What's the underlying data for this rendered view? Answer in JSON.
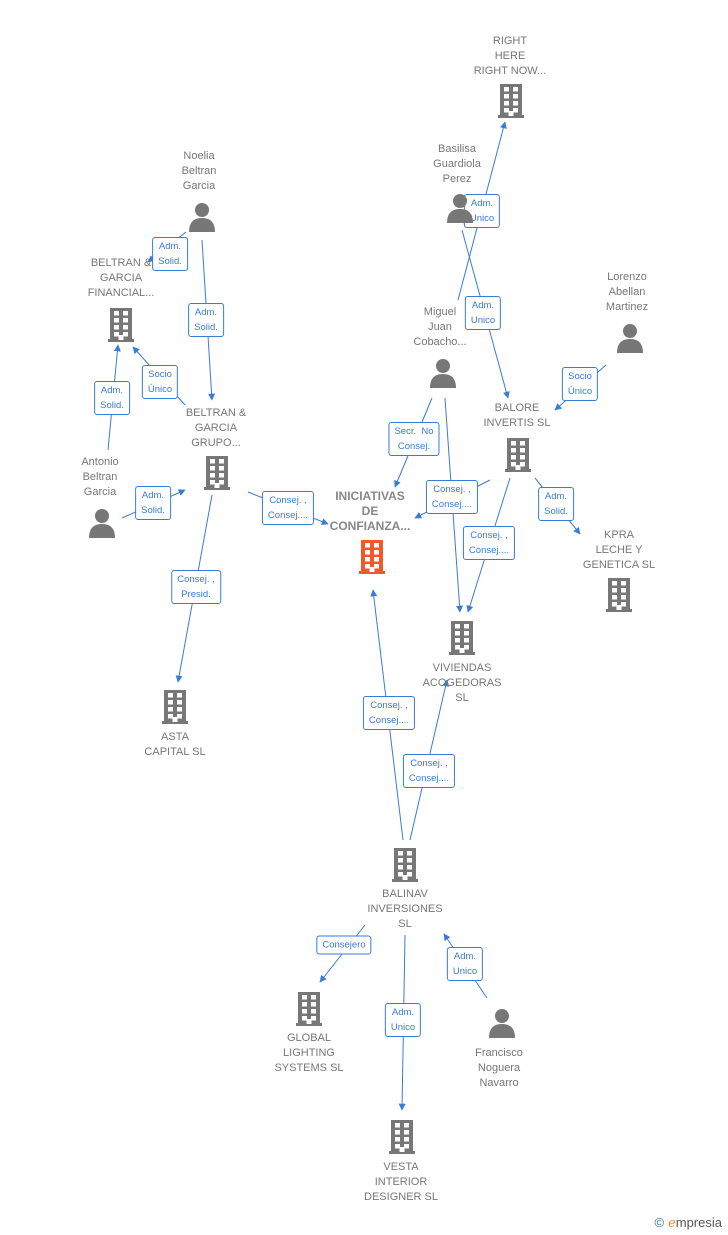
{
  "nodes": [
    {
      "id": "right_here",
      "label": "RIGHT\nHERE\nRIGHT NOW...",
      "type": "company"
    },
    {
      "id": "noelia",
      "label": "Noelia\nBeltran\nGarcia",
      "type": "person"
    },
    {
      "id": "basilisa",
      "label": "Basilisa\nGuardiola\nPerez",
      "type": "person"
    },
    {
      "id": "beltran_fin",
      "label": "BELTRAN &\nGARCIA\nFINANCIAL...",
      "type": "company"
    },
    {
      "id": "lorenzo",
      "label": "Lorenzo\nAbellan\nMartinez",
      "type": "person"
    },
    {
      "id": "miguel",
      "label": "Miguel\nJuan\nCobacho...",
      "type": "person"
    },
    {
      "id": "balore",
      "label": "BALORE\nINVERTIS  SL",
      "type": "company"
    },
    {
      "id": "beltran_grupo",
      "label": "BELTRAN &\nGARCIA\nGRUPO...",
      "type": "company"
    },
    {
      "id": "antonio",
      "label": "Antonio\nBeltran\nGarcia",
      "type": "person"
    },
    {
      "id": "iniciativas",
      "label": "INICIATIVAS\nDE\nCONFIANZA...",
      "type": "company-main"
    },
    {
      "id": "kpra",
      "label": "KPRA\nLECHE Y\nGENETICA  SL",
      "type": "company"
    },
    {
      "id": "viviendas",
      "label": "VIVIENDAS\nACOGEDORAS\nSL",
      "type": "company"
    },
    {
      "id": "asta",
      "label": "ASTA\nCAPITAL  SL",
      "type": "company"
    },
    {
      "id": "balinav",
      "label": "BALINAV\nINVERSIONES\nSL",
      "type": "company"
    },
    {
      "id": "global",
      "label": "GLOBAL\nLIGHTING\nSYSTEMS  SL",
      "type": "company"
    },
    {
      "id": "francisco",
      "label": "Francisco\nNoguera\nNavarro",
      "type": "person"
    },
    {
      "id": "vesta",
      "label": "VESTA\nINTERIOR\nDESIGNER  SL",
      "type": "company"
    }
  ],
  "edges": [
    {
      "from": "noelia",
      "to": "beltran_grupo",
      "label": "Adm.\nSolid."
    },
    {
      "from": "noelia",
      "to": "beltran_fin",
      "label": "Adm.\nSolid."
    },
    {
      "from": "antonio",
      "to": "beltran_fin",
      "label": "Adm.\nSolid."
    },
    {
      "from": "beltran_grupo",
      "to": "beltran_fin",
      "label": "Socio\nÚnico"
    },
    {
      "from": "antonio",
      "to": "beltran_grupo",
      "label": "Adm.\nSolid."
    },
    {
      "from": "beltran_grupo",
      "to": "iniciativas",
      "label": "Consej. ,\nConsej...."
    },
    {
      "from": "beltran_grupo",
      "to": "asta",
      "label": "Consej. ,\nPresid."
    },
    {
      "from": "miguel",
      "to": "iniciativas",
      "label": "Secr.  No\nConsej."
    },
    {
      "from": "miguel",
      "to": "viviendas",
      "label": ""
    },
    {
      "from": "miguel",
      "to": "right_here",
      "label": "Adm.\nUnico"
    },
    {
      "from": "basilisa",
      "to": "balore",
      "label": "Adm.\nUnico"
    },
    {
      "from": "lorenzo",
      "to": "balore",
      "label": "Socio\nÚnico"
    },
    {
      "from": "balore",
      "to": "iniciativas",
      "label": "Consej. ,\nConsej...."
    },
    {
      "from": "balore",
      "to": "viviendas",
      "label": "Consej. ,\nConsej...."
    },
    {
      "from": "balore",
      "to": "kpra",
      "label": "Adm.\nSolid."
    },
    {
      "from": "balinav",
      "to": "iniciativas",
      "label": "Consej. ,\nConsej...."
    },
    {
      "from": "balinav",
      "to": "viviendas",
      "label": "Consej. ,\nConsej...."
    },
    {
      "from": "balinav",
      "to": "global",
      "label": "Consejero"
    },
    {
      "from": "balinav",
      "to": "vesta",
      "label": "Adm.\nUnico"
    },
    {
      "from": "francisco",
      "to": "balinav",
      "label": "Adm.\nUnico"
    }
  ],
  "colors": {
    "edge": "#3a7bd5",
    "node": "#777777",
    "main": "#f05a28"
  },
  "brand": {
    "copyright": "©",
    "name_initial": "e",
    "name_rest": "mpresia"
  }
}
